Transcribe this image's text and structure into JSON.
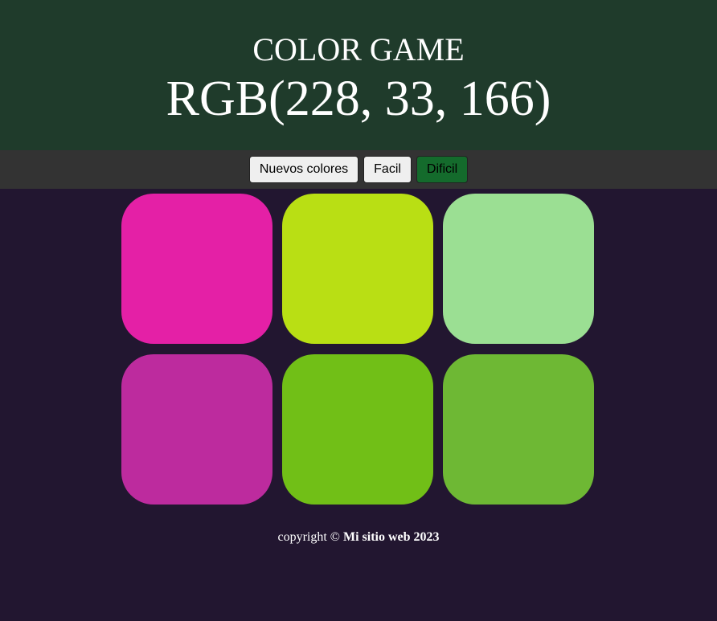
{
  "header": {
    "title": "COLOR GAME",
    "rgb": "RGB(228, 33, 166)"
  },
  "toolbar": {
    "new_colors_label": "Nuevos colores",
    "easy_label": "Facil",
    "hard_label": "Dificil",
    "active_mode": "Dificil",
    "active_color": "#146b2c"
  },
  "squares": [
    {
      "color": "#e420a6"
    },
    {
      "color": "#b9df14"
    },
    {
      "color": "#9bdf93"
    },
    {
      "color": "#bd2b9e"
    },
    {
      "color": "#71bf17"
    },
    {
      "color": "#6eb834"
    }
  ],
  "footer": {
    "prefix": "copyright ©",
    "site": "Mi sitio web 2023"
  },
  "colors": {
    "header_bg": "#1f3b2b",
    "toolbar_bg": "#333333",
    "page_bg": "#221630"
  }
}
